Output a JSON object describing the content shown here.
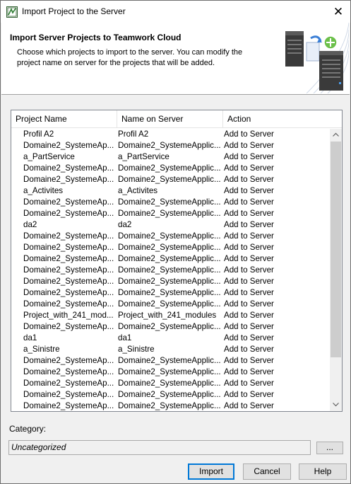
{
  "window": {
    "title": "Import Project to the Server",
    "close_glyph": "✕"
  },
  "banner": {
    "title": "Import Server Projects to Teamwork Cloud",
    "description": "Choose which projects to import to the server. You can modify the project name on server for the projects that will be added."
  },
  "table": {
    "columns": [
      "Project Name",
      "Name on Server",
      "Action"
    ],
    "rows": [
      [
        "Profil A2",
        "Profil A2",
        "Add to Server"
      ],
      [
        "Domaine2_SystemeAp...",
        "Domaine2_SystemeApplic...",
        "Add to Server"
      ],
      [
        "a_PartService",
        "a_PartService",
        "Add to Server"
      ],
      [
        "Domaine2_SystemeAp...",
        "Domaine2_SystemeApplic...",
        "Add to Server"
      ],
      [
        "Domaine2_SystemeAp...",
        "Domaine2_SystemeApplic...",
        "Add to Server"
      ],
      [
        "a_Activites",
        "a_Activites",
        "Add to Server"
      ],
      [
        "Domaine2_SystemeAp...",
        "Domaine2_SystemeApplic...",
        "Add to Server"
      ],
      [
        "Domaine2_SystemeAp...",
        "Domaine2_SystemeApplic...",
        "Add to Server"
      ],
      [
        "da2",
        "da2",
        "Add to Server"
      ],
      [
        "Domaine2_SystemeAp...",
        "Domaine2_SystemeApplic...",
        "Add to Server"
      ],
      [
        "Domaine2_SystemeAp...",
        "Domaine2_SystemeApplic...",
        "Add to Server"
      ],
      [
        "Domaine2_SystemeAp...",
        "Domaine2_SystemeApplic...",
        "Add to Server"
      ],
      [
        "Domaine2_SystemeAp...",
        "Domaine2_SystemeApplic...",
        "Add to Server"
      ],
      [
        "Domaine2_SystemeAp...",
        "Domaine2_SystemeApplic...",
        "Add to Server"
      ],
      [
        "Domaine2_SystemeAp...",
        "Domaine2_SystemeApplic...",
        "Add to Server"
      ],
      [
        "Domaine2_SystemeAp...",
        "Domaine2_SystemeApplic...",
        "Add to Server"
      ],
      [
        "Project_with_241_mod...",
        "Project_with_241_modules",
        "Add to Server"
      ],
      [
        "Domaine2_SystemeAp...",
        "Domaine2_SystemeApplic...",
        "Add to Server"
      ],
      [
        "da1",
        "da1",
        "Add to Server"
      ],
      [
        "a_Sinistre",
        "a_Sinistre",
        "Add to Server"
      ],
      [
        "Domaine2_SystemeAp...",
        "Domaine2_SystemeApplic...",
        "Add to Server"
      ],
      [
        "Domaine2_SystemeAp...",
        "Domaine2_SystemeApplic...",
        "Add to Server"
      ],
      [
        "Domaine2_SystemeAp...",
        "Domaine2_SystemeApplic...",
        "Add to Server"
      ],
      [
        "Domaine2_SystemeAp...",
        "Domaine2_SystemeApplic...",
        "Add to Server"
      ],
      [
        "Domaine2_SystemeAp...",
        "Domaine2_SystemeApplic...",
        "Add to Server"
      ]
    ]
  },
  "category": {
    "label": "Category:",
    "value": "Uncategorized",
    "browse_label": "..."
  },
  "buttons": {
    "import": "Import",
    "cancel": "Cancel",
    "help": "Help"
  },
  "icons": {
    "scroll_up": "chevron-up-icon",
    "scroll_down": "chevron-down-icon",
    "app": "magicdraw-app-icon",
    "banner": "server-import-icon"
  },
  "colors": {
    "accent": "#0078d7",
    "server_dark": "#3a3a3a",
    "plus_green": "#6cc04a"
  }
}
